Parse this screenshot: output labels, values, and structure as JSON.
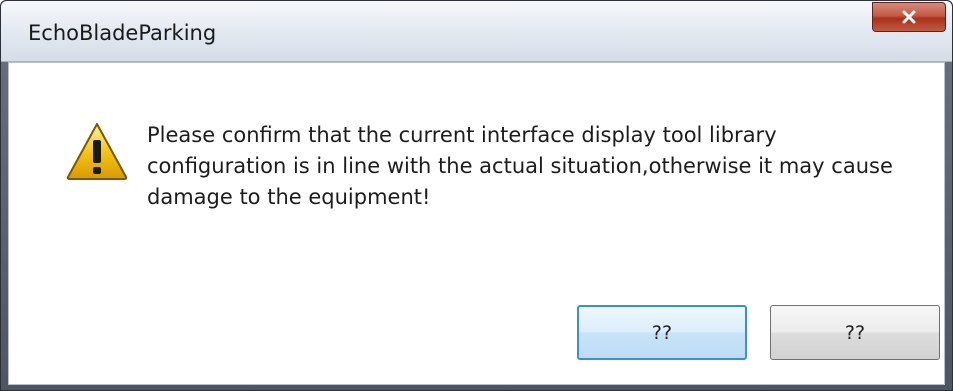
{
  "window": {
    "title": "EchoBladeParking",
    "close_icon": "close-icon"
  },
  "dialog": {
    "icon": "warning-icon",
    "message": "Please confirm that the current interface display tool library configuration is in line with the actual situation,otherwise it may cause damage to the equipment!"
  },
  "buttons": {
    "primary_label": "??",
    "secondary_label": "??"
  },
  "colors": {
    "warning_fill": "#f5c518",
    "warning_stroke": "#7a5a00",
    "close_red": "#c45a46",
    "default_button_border": "#3c8fd6"
  }
}
